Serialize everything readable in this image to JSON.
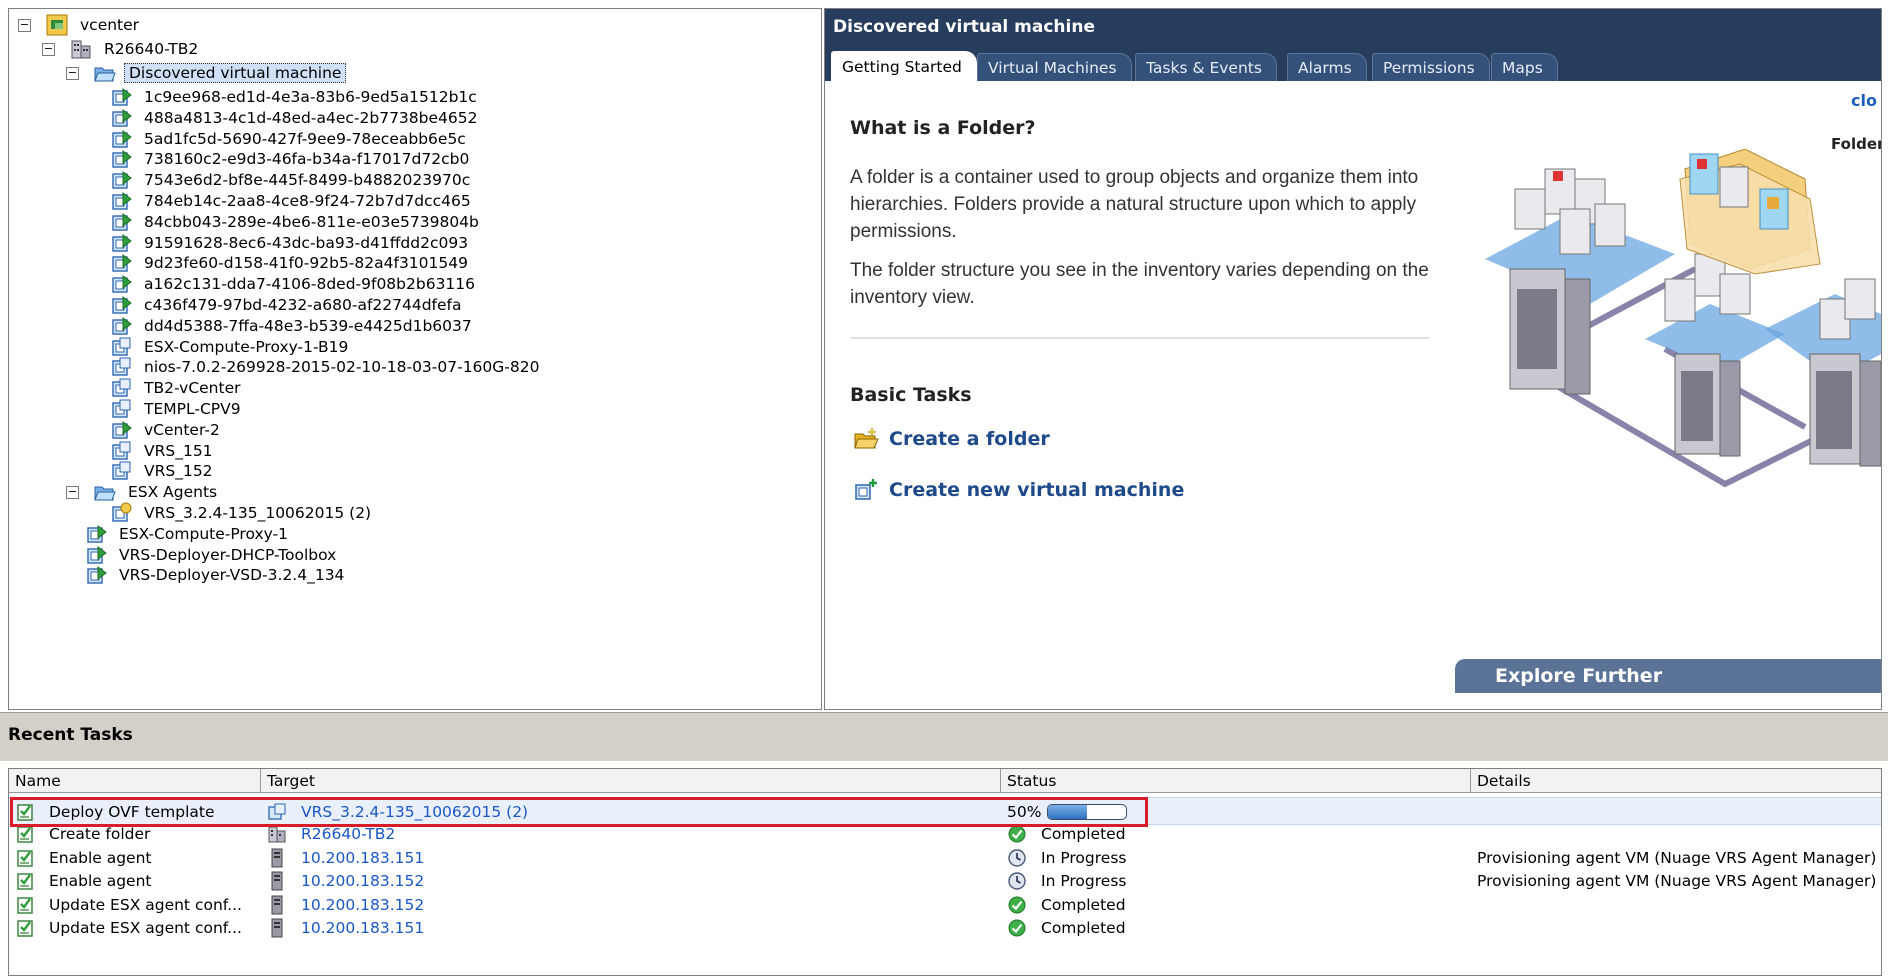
{
  "tree": {
    "root": {
      "label": "vcenter",
      "toggle": "−"
    },
    "datacenter": {
      "label": "R26640-TB2",
      "toggle": "−"
    },
    "folder1": {
      "label": "Discovered virtual machine",
      "toggle": "−"
    },
    "folder1_items": [
      {
        "label": "1c9ee968-ed1d-4e3a-83b6-9ed5a1512b1c",
        "icon": "vm-on-icon"
      },
      {
        "label": "488a4813-4c1d-48ed-a4ec-2b7738be4652",
        "icon": "vm-on-icon"
      },
      {
        "label": "5ad1fc5d-5690-427f-9ee9-78eceabb6e5c",
        "icon": "vm-on-icon"
      },
      {
        "label": "738160c2-e9d3-46fa-b34a-f17017d72cb0",
        "icon": "vm-on-icon"
      },
      {
        "label": "7543e6d2-bf8e-445f-8499-b4882023970c",
        "icon": "vm-on-icon"
      },
      {
        "label": "784eb14c-2aa8-4ce8-9f24-72b7d7dcc465",
        "icon": "vm-on-icon"
      },
      {
        "label": "84cbb043-289e-4be6-811e-e03e5739804b",
        "icon": "vm-on-icon"
      },
      {
        "label": "91591628-8ec6-43dc-ba93-d41ffdd2c093",
        "icon": "vm-on-icon"
      },
      {
        "label": "9d23fe60-d158-41f0-92b5-82a4f3101549",
        "icon": "vm-on-icon"
      },
      {
        "label": "a162c131-dda7-4106-8ded-9f08b2b63116",
        "icon": "vm-on-icon"
      },
      {
        "label": "c436f479-97bd-4232-a680-af22744dfefa",
        "icon": "vm-on-icon"
      },
      {
        "label": "dd4d5388-7ffa-48e3-b539-e4425d1b6037",
        "icon": "vm-on-icon"
      },
      {
        "label": "ESX-Compute-Proxy-1-B19",
        "icon": "vm-off-icon"
      },
      {
        "label": "nios-7.0.2-269928-2015-02-10-18-03-07-160G-820",
        "icon": "vm-off-icon"
      },
      {
        "label": "TB2-vCenter",
        "icon": "vm-off-icon"
      },
      {
        "label": "TEMPL-CPV9",
        "icon": "vm-off-icon"
      },
      {
        "label": "vCenter-2",
        "icon": "vm-on-icon"
      },
      {
        "label": "VRS_151",
        "icon": "vm-off-icon"
      },
      {
        "label": "VRS_152",
        "icon": "vm-off-icon"
      }
    ],
    "folder2": {
      "label": "ESX Agents",
      "toggle": "−"
    },
    "folder2_items": [
      {
        "label": "VRS_3.2.4-135_10062015 (2)",
        "icon": "vm-deploying-icon"
      }
    ],
    "root_items": [
      {
        "label": "ESX-Compute-Proxy-1",
        "icon": "vm-on-icon"
      },
      {
        "label": "VRS-Deployer-DHCP-Toolbox",
        "icon": "vm-on-icon"
      },
      {
        "label": "VRS-Deployer-VSD-3.2.4_134",
        "icon": "vm-on-icon"
      }
    ]
  },
  "detail": {
    "title": "Discovered virtual machine",
    "tabs": [
      "Getting Started",
      "Virtual Machines",
      "Tasks & Events",
      "Alarms",
      "Permissions",
      "Maps"
    ],
    "close_link": "clo",
    "heading": "What is a Folder?",
    "para1": "A folder is a container used to group objects and organize them into hierarchies. Folders provide a natural structure upon which to apply permissions.",
    "para2": "The folder structure you see in the inventory varies depending on the inventory view.",
    "basic_tasks": "Basic Tasks",
    "task_links": [
      "Create a folder",
      "Create new virtual machine"
    ],
    "illustration_label": "Folder",
    "explore": "Explore Further"
  },
  "recent_tasks": {
    "title": "Recent Tasks",
    "columns": [
      "Name",
      "Target",
      "Status",
      "Details"
    ],
    "rows": [
      {
        "name": "Deploy OVF template",
        "target": "VRS_3.2.4-135_10062015 (2)",
        "target_icon": "vm-template-icon",
        "status": "50%",
        "progress": 0.5,
        "details": ""
      },
      {
        "name": "Create folder",
        "target": "R26640-TB2",
        "target_icon": "datacenter-icon",
        "status": "Completed",
        "status_icon": "check-icon",
        "details": ""
      },
      {
        "name": "Enable agent",
        "target": "10.200.183.151",
        "target_icon": "host-icon",
        "status": "In Progress",
        "status_icon": "clock-icon",
        "details": "Provisioning agent VM (Nuage VRS Agent Manager)"
      },
      {
        "name": "Enable agent",
        "target": "10.200.183.152",
        "target_icon": "host-icon",
        "status": "In Progress",
        "status_icon": "clock-icon",
        "details": "Provisioning agent VM (Nuage VRS Agent Manager)"
      },
      {
        "name": "Update ESX agent conf...",
        "target": "10.200.183.152",
        "target_icon": "host-icon",
        "status": "Completed",
        "status_icon": "check-icon",
        "details": ""
      },
      {
        "name": "Update ESX agent conf...",
        "target": "10.200.183.151",
        "target_icon": "host-icon",
        "status": "Completed",
        "status_icon": "check-icon",
        "details": ""
      }
    ]
  },
  "colors": {
    "header_bg": "#263d5e",
    "link": "#1a57c8",
    "highlight": "#d81c2a"
  }
}
